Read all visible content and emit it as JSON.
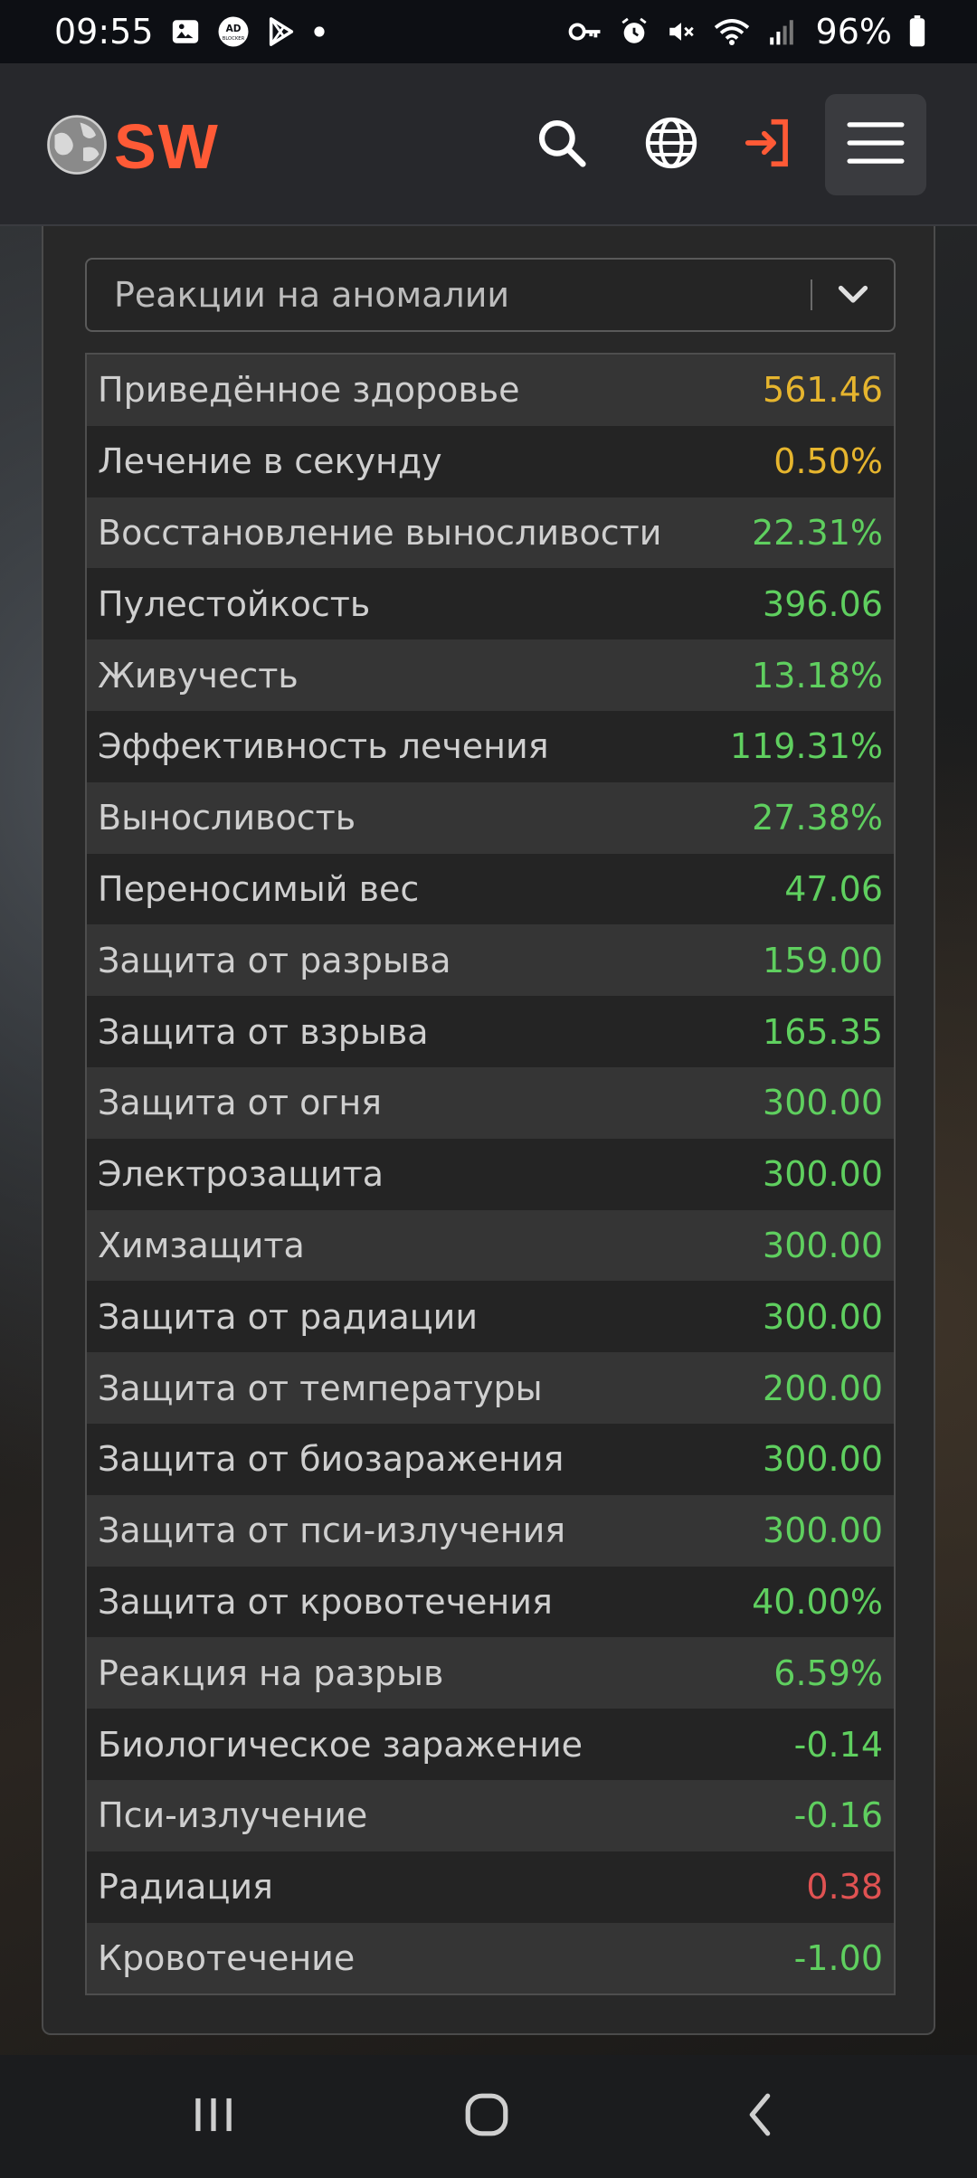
{
  "status_bar": {
    "time": "09:55",
    "battery_pct": "96%",
    "left_icons": [
      "gallery-icon",
      "adblocker-icon",
      "play-store-icon",
      "dot-icon"
    ],
    "right_icons": [
      "key-icon",
      "alarm-icon",
      "mute-icon",
      "wifi-icon",
      "signal-icon",
      "battery-icon"
    ]
  },
  "header": {
    "logo_text": "SW",
    "icons": [
      "search-icon",
      "globe-icon",
      "login-icon",
      "hamburger-menu-icon"
    ]
  },
  "selector": {
    "value": "Реакции на аномалии"
  },
  "stats": [
    {
      "label": "Приведённое здоровье",
      "value": "561.46",
      "color": "#e6b52e"
    },
    {
      "label": "Лечение в секунду",
      "value": "0.50%",
      "color": "#e6b52e"
    },
    {
      "label": "Восстановление выносливости",
      "value": "22.31%",
      "color": "#5fcf5f"
    },
    {
      "label": "Пулестойкость",
      "value": "396.06",
      "color": "#5fcf5f"
    },
    {
      "label": "Живучесть",
      "value": "13.18%",
      "color": "#5fcf5f"
    },
    {
      "label": "Эффективность лечения",
      "value": "119.31%",
      "color": "#5fcf5f"
    },
    {
      "label": "Выносливость",
      "value": "27.38%",
      "color": "#5fcf5f"
    },
    {
      "label": "Переносимый вес",
      "value": "47.06",
      "color": "#5fcf5f"
    },
    {
      "label": "Защита от разрыва",
      "value": "159.00",
      "color": "#5fcf5f"
    },
    {
      "label": "Защита от взрыва",
      "value": "165.35",
      "color": "#5fcf5f"
    },
    {
      "label": "Защита от огня",
      "value": "300.00",
      "color": "#5fcf5f"
    },
    {
      "label": "Электрозащита",
      "value": "300.00",
      "color": "#5fcf5f"
    },
    {
      "label": "Химзащита",
      "value": "300.00",
      "color": "#5fcf5f"
    },
    {
      "label": "Защита от радиации",
      "value": "300.00",
      "color": "#5fcf5f"
    },
    {
      "label": "Защита от температуры",
      "value": "200.00",
      "color": "#5fcf5f"
    },
    {
      "label": "Защита от биозаражения",
      "value": "300.00",
      "color": "#5fcf5f"
    },
    {
      "label": "Защита от пси-излучения",
      "value": "300.00",
      "color": "#5fcf5f"
    },
    {
      "label": "Защита от кровотечения",
      "value": "40.00%",
      "color": "#5fcf5f"
    },
    {
      "label": "Реакция на разрыв",
      "value": "6.59%",
      "color": "#5fcf5f"
    },
    {
      "label": "Биологическое заражение",
      "value": "-0.14",
      "color": "#5fcf5f"
    },
    {
      "label": "Пси-излучение",
      "value": "-0.16",
      "color": "#5fcf5f"
    },
    {
      "label": "Радиация",
      "value": "0.38",
      "color": "#e05252"
    },
    {
      "label": "Кровотечение",
      "value": "-1.00",
      "color": "#5fcf5f"
    }
  ],
  "nav_bar": {
    "icons": [
      "recent-apps-icon",
      "home-icon",
      "back-icon"
    ]
  },
  "colors": {
    "accent": "#ff5a36",
    "positive": "#5fcf5f",
    "highlight": "#e6b52e",
    "negative": "#e05252"
  }
}
